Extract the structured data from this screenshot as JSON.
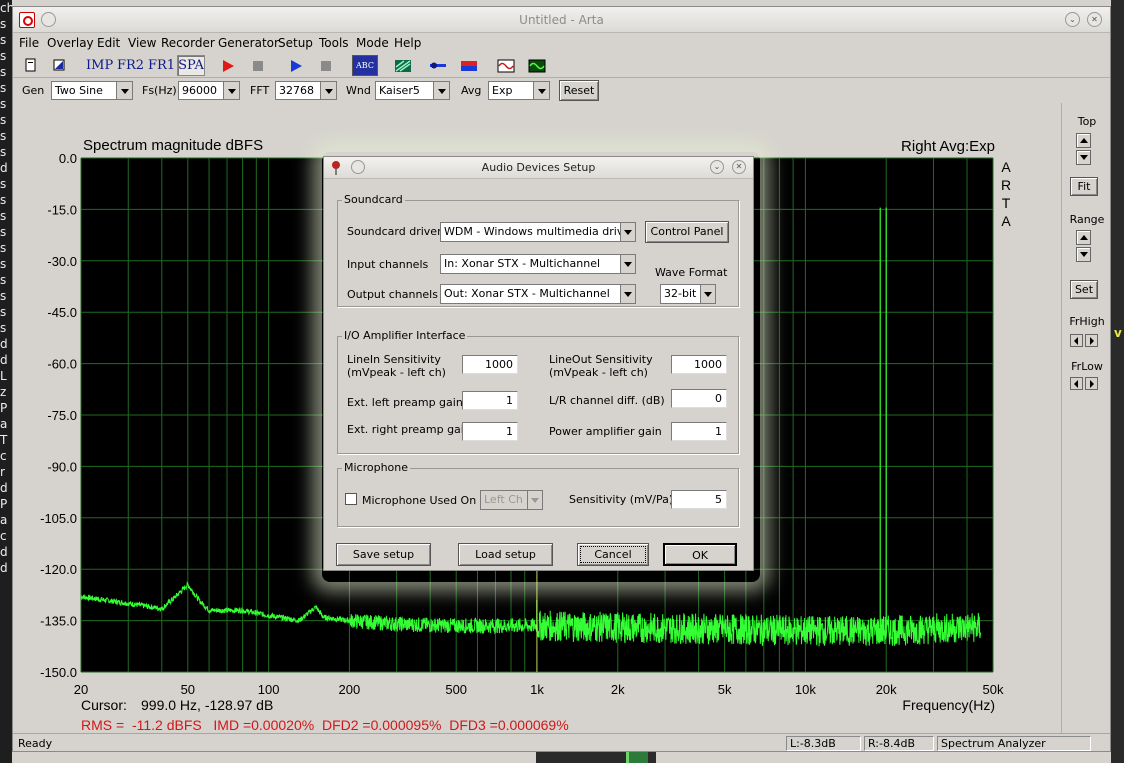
{
  "window": {
    "title": "Untitled - Arta"
  },
  "menu": [
    "File",
    "Overlay",
    "Edit",
    "View",
    "Recorder",
    "Generator",
    "Setup",
    "Tools",
    "Mode",
    "Help"
  ],
  "toolbar": {
    "imp": "IMP",
    "fr2": "FR2",
    "fr1": "FR1",
    "spa": "SPA",
    "abc": "ABC"
  },
  "params": {
    "gen_label": "Gen",
    "gen_value": "Two Sine",
    "fs_label": "Fs(Hz)",
    "fs_value": "96000",
    "fft_label": "FFT",
    "fft_value": "32768",
    "wnd_label": "Wnd",
    "wnd_value": "Kaiser5",
    "avg_label": "Avg",
    "avg_value": "Exp",
    "reset_label": "Reset"
  },
  "plot": {
    "title_left": "Spectrum magnitude dBFS",
    "title_right": "Right Avg:Exp",
    "arta": [
      "A",
      "R",
      "T",
      "A"
    ],
    "cursor_label": "Cursor:",
    "cursor_value": "999.0 Hz, -128.97 dB",
    "xaxis_label": "Frequency(Hz)",
    "stats": "RMS =  -11.2 dBFS   IMD =0.00020%  DFD2 =0.000095%  DFD3 =0.000069%"
  },
  "chart_data": {
    "type": "line",
    "x_scale": "log",
    "xlim": [
      20,
      50000
    ],
    "ylim": [
      -150,
      0
    ],
    "x_ticks": [
      "20",
      "50",
      "100",
      "200",
      "500",
      "1k",
      "2k",
      "5k",
      "10k",
      "20k",
      "50k"
    ],
    "y_ticks": [
      "0.0",
      "-15.0",
      "-30.0",
      "-45.0",
      "-60.0",
      "-75.0",
      "-90.0",
      "-105.0",
      "-120.0",
      "-135.0",
      "-150.0"
    ],
    "grid": true,
    "series": [
      {
        "color": "#34ff34",
        "points": [
          [
            20,
            -128
          ],
          [
            30,
            -130
          ],
          [
            40,
            -131.5
          ],
          [
            45,
            -128
          ],
          [
            50,
            -124.5
          ],
          [
            55,
            -129
          ],
          [
            60,
            -132
          ],
          [
            80,
            -132
          ],
          [
            100,
            -133.5
          ],
          [
            130,
            -135
          ],
          [
            150,
            -131
          ],
          [
            160,
            -134
          ],
          [
            200,
            -135
          ],
          [
            300,
            -136
          ],
          [
            500,
            -136.5
          ],
          [
            1000,
            -136.5
          ],
          [
            2000,
            -137
          ],
          [
            5000,
            -137.5
          ],
          [
            10000,
            -138
          ],
          [
            20000,
            -138
          ],
          [
            40000,
            -137
          ]
        ]
      }
    ],
    "spikes": [
      {
        "x": 999,
        "y": -128.97
      },
      {
        "x": 19000,
        "y": -14.5
      },
      {
        "x": 20000,
        "y": -14.5
      }
    ]
  },
  "side": {
    "top": "Top",
    "fit": "Fit",
    "range": "Range",
    "set": "Set",
    "frhigh": "FrHigh",
    "frlow": "FrLow"
  },
  "status": {
    "ready": "Ready",
    "l": "L:-8.3dB",
    "r": "R:-8.4dB",
    "mode": "Spectrum Analyzer"
  },
  "dialog": {
    "title": "Audio Devices Setup",
    "soundcard_group": "Soundcard",
    "driver_label": "Soundcard driver",
    "driver_value": "WDM - Windows multimedia driver",
    "control_panel": "Control Panel",
    "input_label": "Input channels",
    "input_value": "In: Xonar STX - Multichannel",
    "output_label": "Output channels",
    "output_value": "Out: Xonar STX - Multichannel",
    "wave_format_label": "Wave Format",
    "wave_format_value": "32-bit",
    "io_group": "I/O Amplifier Interface",
    "linein_label": "LineIn Sensitivity",
    "linein_sub": "(mVpeak - left ch)",
    "linein_value": "1000",
    "lineout_label": "LineOut Sensitivity",
    "lineout_sub": "(mVpeak - left ch)",
    "lineout_value": "1000",
    "ext_left_label": "Ext. left preamp gain",
    "ext_left_value": "1",
    "lr_diff_label": "L/R channel diff. (dB)",
    "lr_diff_value": "0",
    "ext_right_label": "Ext. right preamp gain",
    "ext_right_value": "1",
    "power_amp_label": "Power amplifier gain",
    "power_amp_value": "1",
    "mic_group": "Microphone",
    "mic_used_label": "Microphone Used On",
    "mic_channel": "Left Ch",
    "mic_sens_label": "Sensitivity (mV/Pa)",
    "mic_sens_value": "5",
    "save": "Save setup",
    "load": "Load setup",
    "cancel": "Cancel",
    "ok": "OK"
  }
}
